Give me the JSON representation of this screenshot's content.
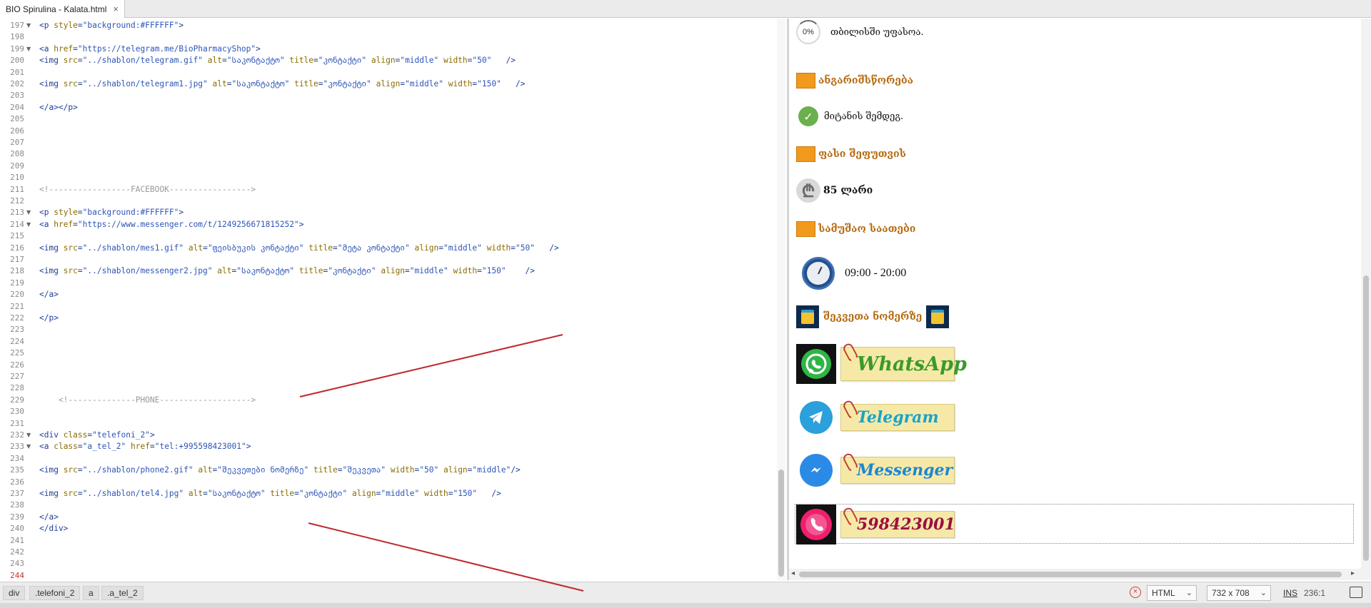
{
  "tab": {
    "title": "BIO Spirulina - Kalata.html",
    "close_glyph": "×"
  },
  "editor": {
    "lines": [
      {
        "n": "197",
        "fold": "▼",
        "code": [
          [
            "t",
            "<p "
          ],
          [
            "a",
            "style"
          ],
          [
            "t",
            "="
          ],
          [
            "v",
            "\"background:#FFFFFF\""
          ],
          [
            "t",
            ">"
          ]
        ]
      },
      {
        "n": "198",
        "fold": "",
        "code": []
      },
      {
        "n": "199",
        "fold": "▼",
        "code": [
          [
            "t",
            "<a "
          ],
          [
            "a",
            "href"
          ],
          [
            "t",
            "="
          ],
          [
            "v",
            "\"https://telegram.me/BioPharmacyShop\""
          ],
          [
            "t",
            ">"
          ]
        ]
      },
      {
        "n": "200",
        "fold": "",
        "code": [
          [
            "t",
            "<img "
          ],
          [
            "a",
            "src"
          ],
          [
            "t",
            "="
          ],
          [
            "v",
            "\"../shablon/telegram.gif\""
          ],
          [
            "t",
            " "
          ],
          [
            "a",
            "alt"
          ],
          [
            "t",
            "="
          ],
          [
            "v",
            "\"საკონტაქტო\""
          ],
          [
            "t",
            " "
          ],
          [
            "a",
            "title"
          ],
          [
            "t",
            "="
          ],
          [
            "v",
            "\"კონტაქტი\""
          ],
          [
            "t",
            " "
          ],
          [
            "a",
            "align"
          ],
          [
            "t",
            "="
          ],
          [
            "v",
            "\"middle\""
          ],
          [
            "t",
            " "
          ],
          [
            "a",
            "width"
          ],
          [
            "t",
            "="
          ],
          [
            "v",
            "\"50\""
          ],
          [
            "t",
            "   />"
          ]
        ]
      },
      {
        "n": "201",
        "fold": "",
        "code": []
      },
      {
        "n": "202",
        "fold": "",
        "code": [
          [
            "t",
            "<img "
          ],
          [
            "a",
            "src"
          ],
          [
            "t",
            "="
          ],
          [
            "v",
            "\"../shablon/telegram1.jpg\""
          ],
          [
            "t",
            " "
          ],
          [
            "a",
            "alt"
          ],
          [
            "t",
            "="
          ],
          [
            "v",
            "\"საკონტაქტო\""
          ],
          [
            "t",
            " "
          ],
          [
            "a",
            "title"
          ],
          [
            "t",
            "="
          ],
          [
            "v",
            "\"კონტაქტი\""
          ],
          [
            "t",
            " "
          ],
          [
            "a",
            "align"
          ],
          [
            "t",
            "="
          ],
          [
            "v",
            "\"middle\""
          ],
          [
            "t",
            " "
          ],
          [
            "a",
            "width"
          ],
          [
            "t",
            "="
          ],
          [
            "v",
            "\"150\""
          ],
          [
            "t",
            "   />"
          ]
        ]
      },
      {
        "n": "203",
        "fold": "",
        "code": []
      },
      {
        "n": "204",
        "fold": "",
        "code": [
          [
            "t",
            "</a></p>"
          ]
        ]
      },
      {
        "n": "205",
        "fold": "",
        "code": []
      },
      {
        "n": "206",
        "fold": "",
        "code": []
      },
      {
        "n": "207",
        "fold": "",
        "code": []
      },
      {
        "n": "208",
        "fold": "",
        "code": []
      },
      {
        "n": "209",
        "fold": "",
        "code": []
      },
      {
        "n": "210",
        "fold": "",
        "code": []
      },
      {
        "n": "211",
        "fold": "",
        "code": [
          [
            "c",
            "<!-----------------FACEBOOK----------------->"
          ]
        ]
      },
      {
        "n": "212",
        "fold": "",
        "code": []
      },
      {
        "n": "213",
        "fold": "▼",
        "code": [
          [
            "t",
            "<p "
          ],
          [
            "a",
            "style"
          ],
          [
            "t",
            "="
          ],
          [
            "v",
            "\"background:#FFFFFF\""
          ],
          [
            "t",
            ">"
          ]
        ]
      },
      {
        "n": "214",
        "fold": "▼",
        "code": [
          [
            "t",
            "<a "
          ],
          [
            "a",
            "href"
          ],
          [
            "t",
            "="
          ],
          [
            "v",
            "\"https://www.messenger.com/t/1249256671815252\""
          ],
          [
            "t",
            ">"
          ]
        ]
      },
      {
        "n": "215",
        "fold": "",
        "code": []
      },
      {
        "n": "216",
        "fold": "",
        "code": [
          [
            "t",
            "<img "
          ],
          [
            "a",
            "src"
          ],
          [
            "t",
            "="
          ],
          [
            "v",
            "\"../shablon/mes1.gif\""
          ],
          [
            "t",
            " "
          ],
          [
            "a",
            "alt"
          ],
          [
            "t",
            "="
          ],
          [
            "v",
            "\"ფეისბუკის კონტაქტი\""
          ],
          [
            "t",
            " "
          ],
          [
            "a",
            "title"
          ],
          [
            "t",
            "="
          ],
          [
            "v",
            "\"მეტა კონტაქტი\""
          ],
          [
            "t",
            " "
          ],
          [
            "a",
            "align"
          ],
          [
            "t",
            "="
          ],
          [
            "v",
            "\"middle\""
          ],
          [
            "t",
            " "
          ],
          [
            "a",
            "width"
          ],
          [
            "t",
            "="
          ],
          [
            "v",
            "\"50\""
          ],
          [
            "t",
            "   />"
          ]
        ]
      },
      {
        "n": "217",
        "fold": "",
        "code": []
      },
      {
        "n": "218",
        "fold": "",
        "code": [
          [
            "t",
            "<img "
          ],
          [
            "a",
            "src"
          ],
          [
            "t",
            "="
          ],
          [
            "v",
            "\"../shablon/messenger2.jpg\""
          ],
          [
            "t",
            " "
          ],
          [
            "a",
            "alt"
          ],
          [
            "t",
            "="
          ],
          [
            "v",
            "\"საკონტაქტო\""
          ],
          [
            "t",
            " "
          ],
          [
            "a",
            "title"
          ],
          [
            "t",
            "="
          ],
          [
            "v",
            "\"კონტაქტი\""
          ],
          [
            "t",
            " "
          ],
          [
            "a",
            "align"
          ],
          [
            "t",
            "="
          ],
          [
            "v",
            "\"middle\""
          ],
          [
            "t",
            " "
          ],
          [
            "a",
            "width"
          ],
          [
            "t",
            "="
          ],
          [
            "v",
            "\"150\""
          ],
          [
            "t",
            "    />"
          ]
        ]
      },
      {
        "n": "219",
        "fold": "",
        "code": []
      },
      {
        "n": "220",
        "fold": "",
        "code": [
          [
            "t",
            "</a>"
          ]
        ]
      },
      {
        "n": "221",
        "fold": "",
        "code": []
      },
      {
        "n": "222",
        "fold": "",
        "code": [
          [
            "t",
            "</p>"
          ]
        ]
      },
      {
        "n": "223",
        "fold": "",
        "code": []
      },
      {
        "n": "224",
        "fold": "",
        "code": []
      },
      {
        "n": "225",
        "fold": "",
        "code": []
      },
      {
        "n": "226",
        "fold": "",
        "code": []
      },
      {
        "n": "227",
        "fold": "",
        "code": []
      },
      {
        "n": "228",
        "fold": "",
        "code": []
      },
      {
        "n": "229",
        "fold": "",
        "code": [
          [
            "c",
            "    <!--------------PHONE------------------->"
          ]
        ]
      },
      {
        "n": "230",
        "fold": "",
        "code": []
      },
      {
        "n": "231",
        "fold": "",
        "code": []
      },
      {
        "n": "232",
        "fold": "▼",
        "code": [
          [
            "t",
            "<div "
          ],
          [
            "a",
            "class"
          ],
          [
            "t",
            "="
          ],
          [
            "v",
            "\"telefoni_2\""
          ],
          [
            "t",
            ">"
          ]
        ]
      },
      {
        "n": "233",
        "fold": "▼",
        "code": [
          [
            "t",
            "<a "
          ],
          [
            "a",
            "class"
          ],
          [
            "t",
            "="
          ],
          [
            "v",
            "\"a_tel_2\""
          ],
          [
            "t",
            " "
          ],
          [
            "a",
            "href"
          ],
          [
            "t",
            "="
          ],
          [
            "v",
            "\"tel:+995598423001\""
          ],
          [
            "t",
            ">"
          ]
        ]
      },
      {
        "n": "234",
        "fold": "",
        "code": []
      },
      {
        "n": "235",
        "fold": "",
        "code": [
          [
            "t",
            "<img "
          ],
          [
            "a",
            "src"
          ],
          [
            "t",
            "="
          ],
          [
            "v",
            "\"../shablon/phone2.gif\""
          ],
          [
            "t",
            " "
          ],
          [
            "a",
            "alt"
          ],
          [
            "t",
            "="
          ],
          [
            "v",
            "\"შეკვეთები ნომერზე\""
          ],
          [
            "t",
            " "
          ],
          [
            "a",
            "title"
          ],
          [
            "t",
            "="
          ],
          [
            "v",
            "\"შეკვეთა\""
          ],
          [
            "t",
            " "
          ],
          [
            "a",
            "width"
          ],
          [
            "t",
            "="
          ],
          [
            "v",
            "\"50\""
          ],
          [
            "t",
            " "
          ],
          [
            "a",
            "align"
          ],
          [
            "t",
            "="
          ],
          [
            "v",
            "\"middle\""
          ],
          [
            "t",
            "/>"
          ]
        ]
      },
      {
        "n": "236",
        "fold": "",
        "code": []
      },
      {
        "n": "237",
        "fold": "",
        "code": [
          [
            "t",
            "<img "
          ],
          [
            "a",
            "src"
          ],
          [
            "t",
            "="
          ],
          [
            "v",
            "\"../shablon/tel4.jpg\""
          ],
          [
            "t",
            " "
          ],
          [
            "a",
            "alt"
          ],
          [
            "t",
            "="
          ],
          [
            "v",
            "\"საკონტაქტო\""
          ],
          [
            "t",
            " "
          ],
          [
            "a",
            "title"
          ],
          [
            "t",
            "="
          ],
          [
            "v",
            "\"კონტაქტი\""
          ],
          [
            "t",
            " "
          ],
          [
            "a",
            "align"
          ],
          [
            "t",
            "="
          ],
          [
            "v",
            "\"middle\""
          ],
          [
            "t",
            " "
          ],
          [
            "a",
            "width"
          ],
          [
            "t",
            "="
          ],
          [
            "v",
            "\"150\""
          ],
          [
            "t",
            "   />"
          ]
        ]
      },
      {
        "n": "238",
        "fold": "",
        "code": []
      },
      {
        "n": "239",
        "fold": "",
        "code": [
          [
            "t",
            "</a>"
          ]
        ]
      },
      {
        "n": "240",
        "fold": "",
        "code": [
          [
            "t",
            "</div>"
          ]
        ]
      },
      {
        "n": "241",
        "fold": "",
        "code": []
      },
      {
        "n": "242",
        "fold": "",
        "code": []
      },
      {
        "n": "243",
        "fold": "",
        "code": []
      },
      {
        "n": "244",
        "fold": "",
        "code": [],
        "current": true
      }
    ]
  },
  "preview": {
    "shipping": {
      "percent": "0%",
      "text": "თბილისში უფასოა."
    },
    "payment_heading": "ანგარიშსწორება",
    "payment_text": "მიტანის შემდეგ.",
    "price_heading": "ფასი შეფუთვის",
    "price_symbol": "₾",
    "price_value": "85 ლარი",
    "hours_heading": "სამუშაო საათები",
    "hours_value": "09:00 - 20:00",
    "order_heading": "შეკვეთა ნომერზე",
    "contacts": [
      {
        "label": "WhatsApp",
        "color": "#3a9a2a",
        "icon": "whatsapp-icon"
      },
      {
        "label": "Telegram",
        "color": "#1aa3c9",
        "icon": "telegram-icon"
      },
      {
        "label": "Messenger",
        "color": "#1f86d0",
        "icon": "messenger-icon"
      },
      {
        "label": "598423001",
        "color": "#9a1040",
        "icon": "phone-icon"
      }
    ]
  },
  "statusbar": {
    "crumbs": [
      "div",
      ".telefoni_2",
      "a",
      ".a_tel_2"
    ],
    "language": "HTML",
    "preview_size": "732 x 708",
    "ins": "INS",
    "cursor": "236:1"
  },
  "colors": {
    "heading": "#b56a10",
    "orange_square": "#f29a1e",
    "annotation_line": "#c0282d"
  }
}
